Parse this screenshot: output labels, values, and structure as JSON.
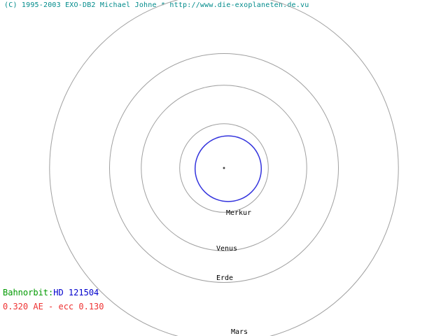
{
  "header": {
    "copyright": "(C) 1995-2003 EXO-DB2 Michael Johne * http://www.die-exoplaneten.de.vu"
  },
  "planet_orbits": [
    {
      "name": "Merkur",
      "semi_major_axis_ae": 0.387
    },
    {
      "name": "Venus",
      "semi_major_axis_ae": 0.723
    },
    {
      "name": "Erde",
      "semi_major_axis_ae": 1.0
    },
    {
      "name": "Mars",
      "semi_major_axis_ae": 1.524
    }
  ],
  "exoplanet": {
    "label": "Bahnorbit:",
    "name": "HD 121504",
    "semi_major_axis_ae": 0.32,
    "eccentricity": 0.13,
    "params_text": "0.320 AE - ecc 0.130"
  },
  "colors": {
    "background": "#ffffff",
    "copyright": "#008b8b",
    "orbit_line": "#a0a0a0",
    "exo_orbit": "#3333dd",
    "label_green": "#009900",
    "name_blue": "#0000cc",
    "params_red": "#ee3333",
    "text": "#000000"
  }
}
